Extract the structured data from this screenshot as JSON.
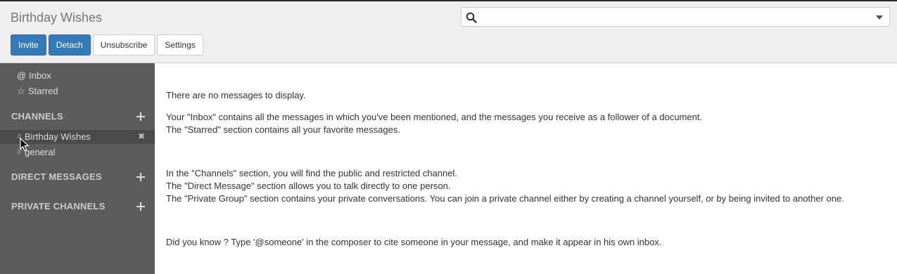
{
  "header": {
    "title": "Birthday Wishes",
    "search": {
      "placeholder": "",
      "icon": "search-icon"
    },
    "buttons": {
      "invite": "Invite",
      "detach": "Detach",
      "unsubscribe": "Unsubscribe",
      "settings": "Settings"
    }
  },
  "sidebar": {
    "inbox": {
      "icon": "@",
      "label": "Inbox"
    },
    "starred": {
      "icon": "☆",
      "label": "Starred"
    },
    "channels_header": "CHANNELS",
    "channels": [
      {
        "hash": "#",
        "name": "Birthday Wishes",
        "close": "✖"
      },
      {
        "hash": "#",
        "name": "general"
      }
    ],
    "direct_messages_header": "DIRECT MESSAGES",
    "private_channels_header": "PRIVATE CHANNELS"
  },
  "main": {
    "empty": "There are no messages to display.",
    "inbox_info": "Your \"Inbox\" contains all the messages in which you've been mentioned, and the messages you receive as a follower of a document.",
    "starred_info": "The \"Starred\" section contains all your favorite messages.",
    "channels_info": "In the \"Channels\" section, you will find the public and restricted channel.",
    "direct_info": "The \"Direct Message\" section allows you to talk directly to one person.",
    "private_info": "The \"Private Group\" section contains your private conversations. You can join a private channel either by creating a channel yourself, or by being invited to another one.",
    "tip": "Did you know ? Type '@someone' in the composer to cite someone in your message, and make it appear in his own inbox."
  },
  "colors": {
    "primary_button": "#337ab7",
    "sidebar_bg": "#5c5c5c",
    "header_bg": "#f0eeee"
  }
}
